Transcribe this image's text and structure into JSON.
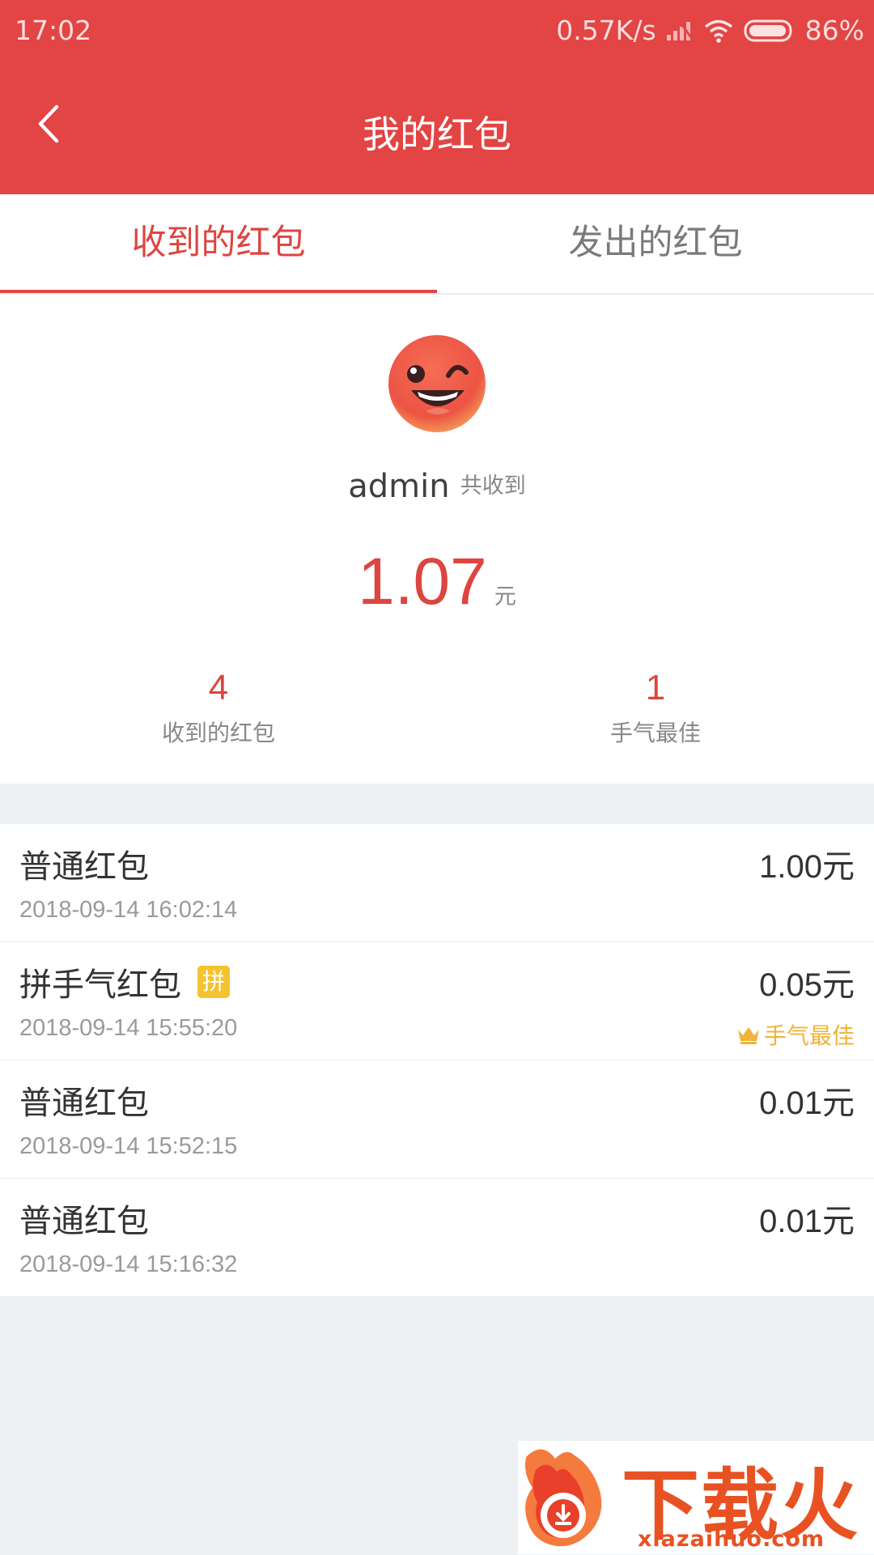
{
  "status_bar": {
    "time": "17:02",
    "network_speed": "0.57K/s",
    "battery": "86%",
    "signal_icon": "signal-icon",
    "wifi_icon": "wifi-icon",
    "battery_icon": "battery-icon"
  },
  "header": {
    "title": "我的红包",
    "back_icon": "back-arrow-icon"
  },
  "tabs": [
    {
      "label": "收到的红包",
      "active": true
    },
    {
      "label": "发出的红包",
      "active": false
    }
  ],
  "summary": {
    "username": "admin",
    "received_label": "共收到",
    "total_amount": "1.07",
    "total_unit": "元",
    "stats": [
      {
        "value": "4",
        "label": "收到的红包"
      },
      {
        "value": "1",
        "label": "手气最佳"
      }
    ]
  },
  "packets": [
    {
      "type": "普通红包",
      "amount": "1.00元",
      "time": "2018-09-14 16:02:14"
    },
    {
      "type": "拼手气红包",
      "badge": "拼",
      "amount": "0.05元",
      "time": "2018-09-14 15:55:20",
      "best_label": "手气最佳"
    },
    {
      "type": "普通红包",
      "amount": "0.01元",
      "time": "2018-09-14 15:52:15"
    },
    {
      "type": "普通红包",
      "amount": "0.01元",
      "time": "2018-09-14 15:16:32"
    }
  ],
  "watermark": {
    "text": "下载火",
    "url": "xiazaihuo.com"
  },
  "colors": {
    "header": "#e34444",
    "accent": "#dd4540",
    "gold": "#f0b43a",
    "background": "#eef1f4"
  }
}
